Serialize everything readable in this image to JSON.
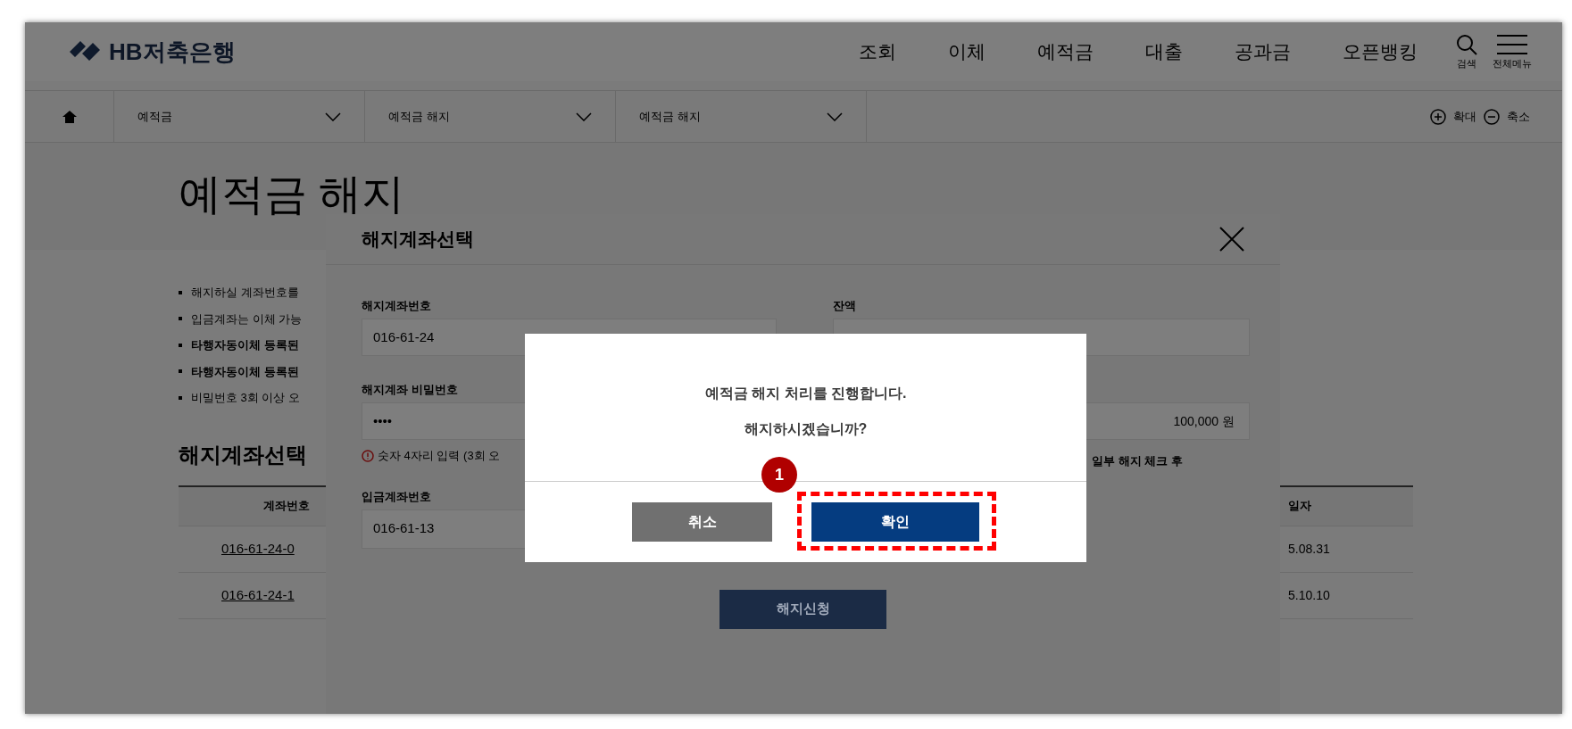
{
  "header": {
    "logo": "HB저축은행",
    "nav": [
      "조회",
      "이체",
      "예적금",
      "대출",
      "공과금",
      "오픈뱅킹"
    ],
    "search_label": "검색",
    "menu_label": "전체메뉴"
  },
  "breadcrumb": {
    "selects": [
      "예적금",
      "예적금 해지",
      "예적금 해지"
    ],
    "zoom_in": "확대",
    "zoom_out": "축소"
  },
  "page": {
    "title": "예적금 해지",
    "notes": [
      {
        "text": "해지하실 계좌번호를",
        "emphasis": false
      },
      {
        "text": "입금계좌는 이체 가능",
        "emphasis": false
      },
      {
        "text": "타행자동이체 등록된",
        "emphasis": true
      },
      {
        "text": "타행자동이체 등록된",
        "emphasis": true
      },
      {
        "text": "비밀번호 3회 이상 오",
        "emphasis": false
      }
    ],
    "section_title": "해지계좌선택",
    "table": {
      "columns": [
        "계좌번호",
        "일자"
      ],
      "rows": [
        [
          "016-61-24-0",
          "5.08.31"
        ],
        [
          "016-61-24-1",
          "5.10.10"
        ]
      ]
    }
  },
  "panel": {
    "title": "해지계좌선택",
    "account": {
      "label": "해지계좌번호",
      "value": "016-61-24"
    },
    "balance": {
      "label": "잔액"
    },
    "password": {
      "label": "해지계좌 비밀번호",
      "value": "••••",
      "hint": "숫자 4자리 입력 (3회 오"
    },
    "amount": {
      "value": "100,000 원"
    },
    "deposit": {
      "label": "입금계좌번호",
      "value": "016-61-13"
    },
    "side_note": "일부 해지 체크 후",
    "submit": "해지신청"
  },
  "alert": {
    "lines": [
      "예적금 해지 처리를 진행합니다.",
      "해지하시겠습니까?"
    ],
    "buttons": [
      {
        "label": "취소",
        "kind": "secondary"
      },
      {
        "label": "확인",
        "kind": "primary"
      }
    ]
  },
  "annotation": {
    "number": "1"
  }
}
